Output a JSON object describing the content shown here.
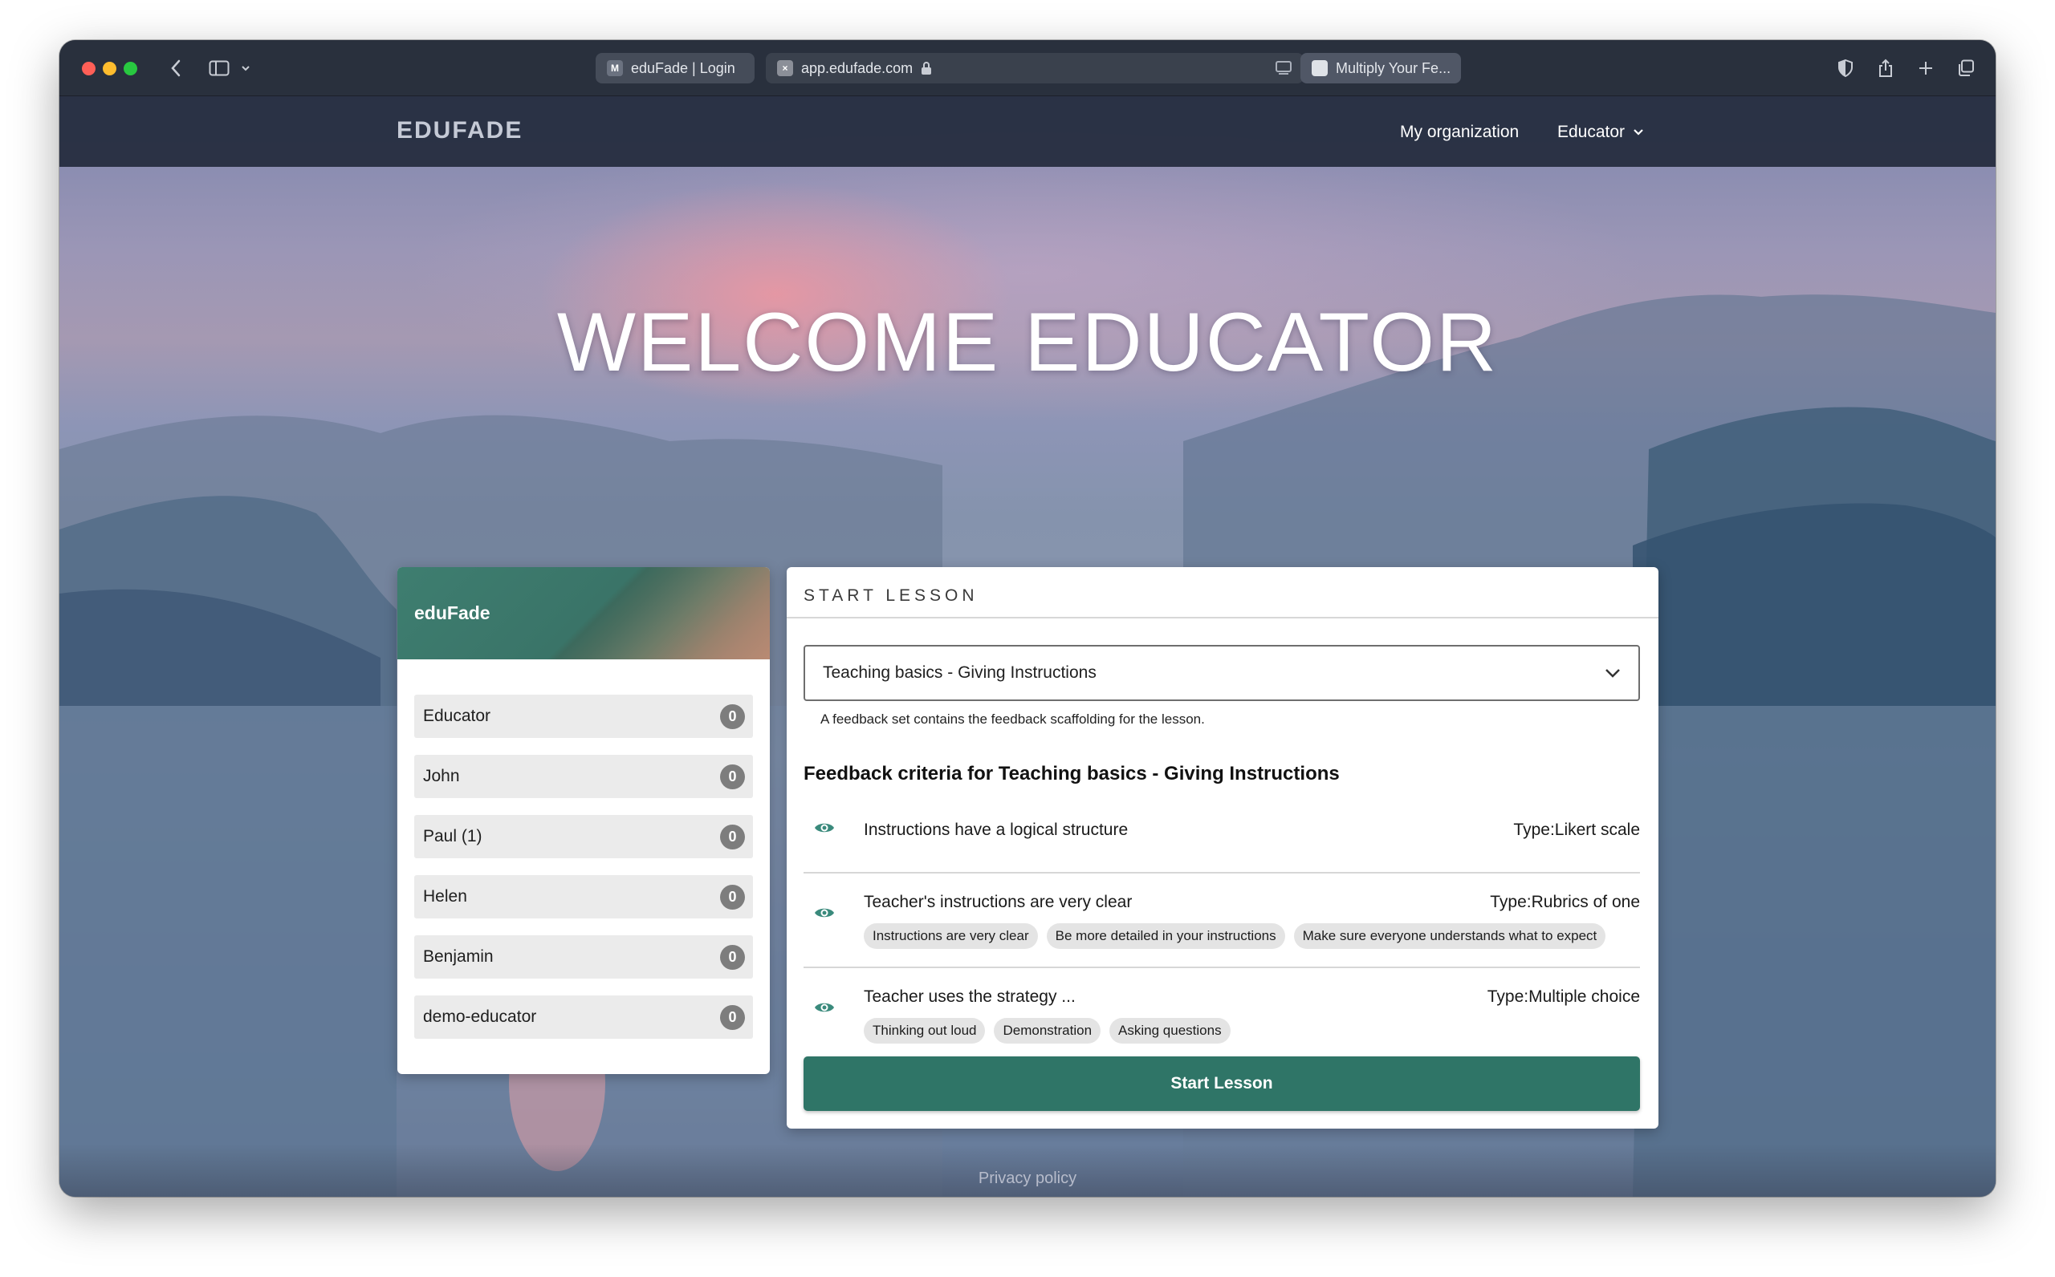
{
  "browser": {
    "tabs": [
      {
        "favicon": "M",
        "title": "eduFade | Login"
      },
      {
        "favicon": "×",
        "title": "app.edufade.com"
      },
      {
        "favicon": "",
        "title": "Multiply Your Fe..."
      }
    ]
  },
  "nav": {
    "logo": "EDUFADE",
    "my_organization": "My organization",
    "user_menu": "Educator"
  },
  "hero": {
    "title": "WELCOME EDUCATOR"
  },
  "team": {
    "title": "eduFade",
    "members": [
      {
        "name": "Educator",
        "count": "0"
      },
      {
        "name": "John",
        "count": "0"
      },
      {
        "name": "Paul (1)",
        "count": "0"
      },
      {
        "name": "Helen",
        "count": "0"
      },
      {
        "name": "Benjamin",
        "count": "0"
      },
      {
        "name": "demo-educator",
        "count": "0"
      }
    ]
  },
  "lesson": {
    "header": "START LESSON",
    "selected_set": "Teaching basics - Giving Instructions",
    "helper": "A feedback set contains the feedback scaffolding for the lesson.",
    "criteria_title": "Feedback criteria for Teaching basics - Giving Instructions",
    "criteria": [
      {
        "title": "Instructions have a logical structure",
        "type": "Type:Likert scale",
        "chips": []
      },
      {
        "title": "Teacher's instructions are very clear",
        "type": "Type:Rubrics of one",
        "chips": [
          "Instructions are very clear",
          "Be more detailed in your instructions",
          "Make sure everyone understands what to expect"
        ]
      },
      {
        "title": "Teacher uses the strategy ...",
        "type": "Type:Multiple choice",
        "chips": [
          "Thinking out loud",
          "Demonstration",
          "Asking questions"
        ]
      }
    ],
    "start_button": "Start Lesson"
  },
  "footer": {
    "privacy": "Privacy policy"
  },
  "colors": {
    "accent": "#2f7567",
    "nav_bg": "#232a3c",
    "eye_icon": "#3a8a7c"
  }
}
